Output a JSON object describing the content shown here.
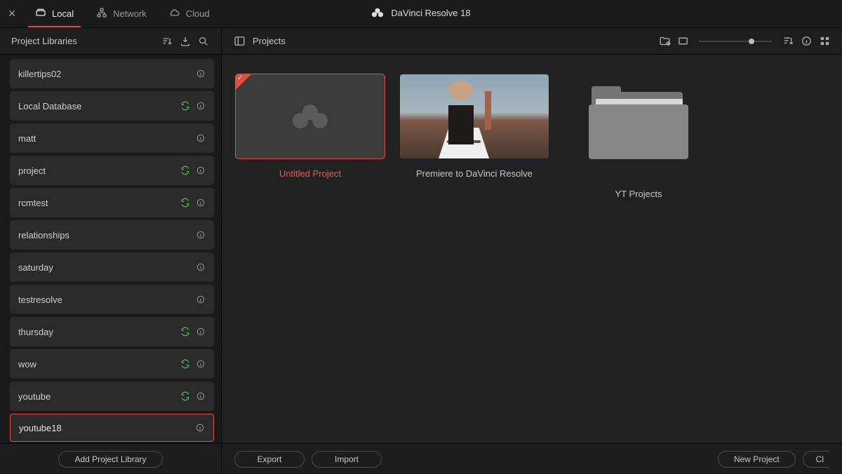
{
  "app": {
    "title": "DaVinci Resolve 18"
  },
  "source_tabs": {
    "local": "Local",
    "network": "Network",
    "cloud": "Cloud"
  },
  "sidebar": {
    "title": "Project Libraries",
    "add_button": "Add Project Library",
    "items": [
      {
        "name": "killertips02",
        "sync": false
      },
      {
        "name": "Local Database",
        "sync": true
      },
      {
        "name": "matt",
        "sync": false
      },
      {
        "name": "project",
        "sync": true
      },
      {
        "name": "rcmtest",
        "sync": true
      },
      {
        "name": "relationships",
        "sync": false
      },
      {
        "name": "saturday",
        "sync": false
      },
      {
        "name": "testresolve",
        "sync": false
      },
      {
        "name": "thursday",
        "sync": true
      },
      {
        "name": "wow",
        "sync": true
      },
      {
        "name": "youtube",
        "sync": true
      },
      {
        "name": "youtube18",
        "sync": false,
        "selected": true
      }
    ]
  },
  "content": {
    "title": "Projects",
    "projects": [
      {
        "title": "Untitled Project"
      },
      {
        "title": "Premiere to DaVinci Resolve"
      },
      {
        "title": "YT Projects"
      }
    ]
  },
  "footer": {
    "export": "Export",
    "import": "Import",
    "new_project": "New Project",
    "close": "Cl"
  }
}
